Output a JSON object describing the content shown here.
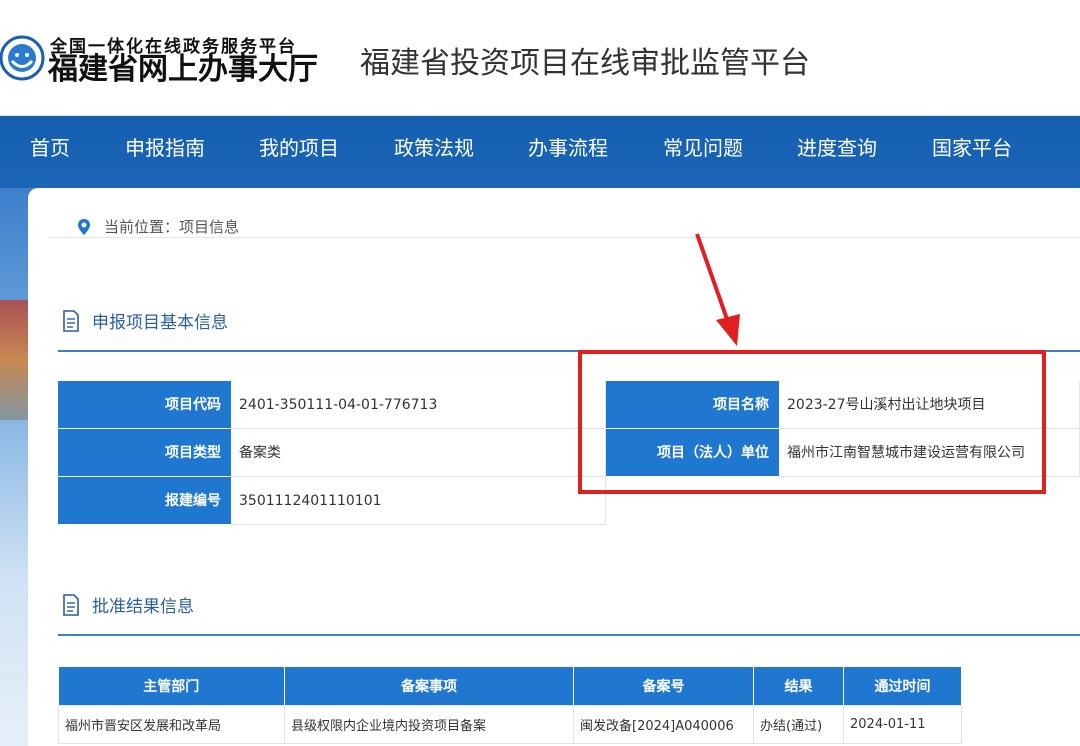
{
  "header": {
    "logo_tagline": "全国一体化在线政务服务平台",
    "logo_name": "福建省网上办事大厅",
    "platform_title": "福建省投资项目在线审批监管平台"
  },
  "nav": {
    "items": [
      {
        "label": "首页"
      },
      {
        "label": "申报指南"
      },
      {
        "label": "我的项目"
      },
      {
        "label": "政策法规"
      },
      {
        "label": "办事流程"
      },
      {
        "label": "常见问题"
      },
      {
        "label": "进度查询"
      },
      {
        "label": "国家平台"
      }
    ]
  },
  "breadcrumb": {
    "icon": "map-pin-icon",
    "text": "当前位置：项目信息"
  },
  "basic_info": {
    "section_title": "申报项目基本信息",
    "rows": [
      {
        "label": "项目代码",
        "value": "2401-350111-04-01-776713"
      },
      {
        "label": "项目类型",
        "value": "备案类"
      },
      {
        "label": "报建编号",
        "value": "3501112401110101"
      }
    ],
    "right_rows": [
      {
        "label": "项目名称",
        "value": "2023-27号山溪村出让地块项目"
      },
      {
        "label": "项目（法人）单位",
        "value": "福州市江南智慧城市建设运营有限公司"
      }
    ]
  },
  "approval": {
    "section_title": "批准结果信息",
    "columns": [
      "主管部门",
      "备案事项",
      "备案号",
      "结果",
      "通过时间"
    ],
    "rows": [
      [
        "福州市晋安区发展和改革局",
        "县级权限内企业境内投资项目备案",
        "闽发改备[2024]A040006",
        "办结(通过)",
        "2024-01-11"
      ]
    ]
  },
  "colors": {
    "nav_bg": "#155fb1",
    "label_bg": "#1f77d0",
    "annotation": "#e21f1f",
    "section_text": "#2a5f9e"
  }
}
